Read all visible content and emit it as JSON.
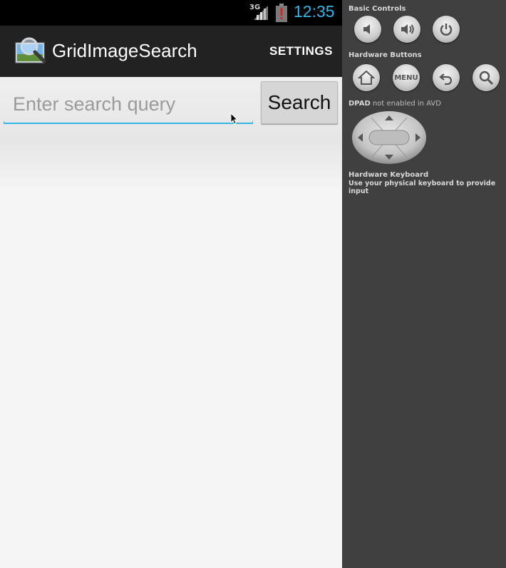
{
  "status_bar": {
    "network": "3G",
    "time": "12:35",
    "icons": [
      "signal-icon",
      "battery-alert-icon"
    ]
  },
  "action_bar": {
    "app_icon": "magnifier-photo-icon",
    "title": "GridImageSearch",
    "settings_label": "SETTINGS"
  },
  "search": {
    "placeholder": "Enter search query",
    "value": "",
    "button_label": "Search"
  },
  "emulator_panel": {
    "basic_controls_label": "Basic Controls",
    "basic_controls": [
      "volume-down-icon",
      "volume-up-icon",
      "power-icon"
    ],
    "hardware_buttons_label": "Hardware Buttons",
    "hardware_buttons": [
      "home-icon",
      "menu-button",
      "back-icon",
      "search-icon"
    ],
    "menu_label": "MENU",
    "dpad_label_strong": "DPAD",
    "dpad_label_rest": " not enabled in AVD",
    "keyboard_title": "Hardware Keyboard",
    "keyboard_desc": "Use your physical keyboard to provide input"
  },
  "colors": {
    "accent": "#33b5e5",
    "action_bar": "#222222",
    "panel": "#404040"
  }
}
